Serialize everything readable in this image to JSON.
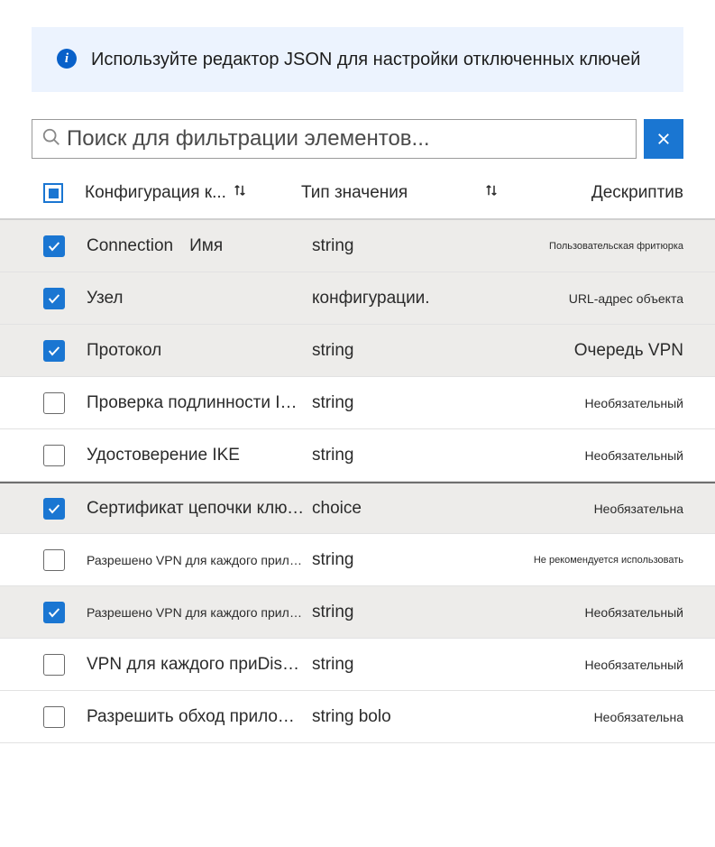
{
  "banner": {
    "text": "Используйте редактор JSON для настройки отключенных ключей"
  },
  "search": {
    "placeholder": "Поиск для фильтрации элементов...",
    "value": ""
  },
  "columns": {
    "config": "Конфигурация к...",
    "type": "Тип значения",
    "description": "Дескриптив"
  },
  "rows": [
    {
      "checked": true,
      "config": "Connection",
      "config_extra": "Имя",
      "config_small": false,
      "type": "string",
      "desc": "Пользовательская фритюрка",
      "desc_size": "tiny"
    },
    {
      "checked": true,
      "config": "Узел",
      "config_extra": "",
      "config_small": false,
      "type": "конфигурации.",
      "desc": "URL-адрес объекта",
      "desc_size": "small"
    },
    {
      "checked": true,
      "config": "Протокол",
      "config_extra": "",
      "config_small": false,
      "type": "string",
      "desc": "Очередь VPN",
      "desc_size": "normal"
    },
    {
      "checked": false,
      "config": "Проверка подлинности IPsec...",
      "config_extra": "",
      "config_small": false,
      "type": "string",
      "desc": "Необязательный",
      "desc_size": "small"
    },
    {
      "checked": false,
      "config": "Удостоверение IKE",
      "config_extra": "",
      "config_small": false,
      "type": "string",
      "desc": "Необязательный",
      "desc_size": "small"
    },
    {
      "checked": true,
      "highlighted": true,
      "config": "Сертификат цепочки ключей...",
      "config_extra": "",
      "config_small": false,
      "type": "choice",
      "desc": "Необязательна",
      "desc_size": "small"
    },
    {
      "checked": false,
      "config": "Разрешено VPN для каждого приложения",
      "config_extra": "",
      "config_small": true,
      "type": "string",
      "desc": "Не рекомендуется использовать",
      "desc_size": "tiny"
    },
    {
      "checked": true,
      "config": "Разрешено VPN для каждого приложения",
      "config_extra": "",
      "config_small": true,
      "type": "string",
      "desc": "Необязательный",
      "desc_size": "small"
    },
    {
      "checked": false,
      "config": "VPN для каждого приDisallewия",
      "config_extra": "",
      "config_small": false,
      "type": "string",
      "desc": "Необязательный",
      "desc_size": "small"
    },
    {
      "checked": false,
      "config": "Разрешить обход приложений",
      "config_extra": "",
      "config_small": false,
      "type": "string bolo",
      "desc": "Необязательна",
      "desc_size": "small"
    }
  ]
}
